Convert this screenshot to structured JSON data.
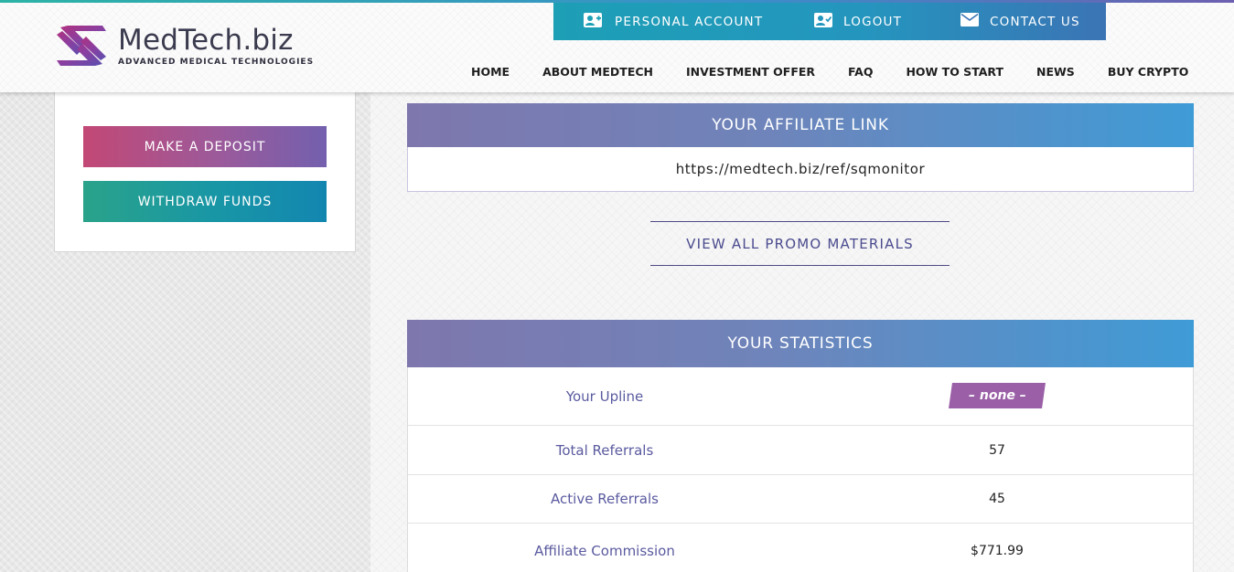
{
  "brand": {
    "name": "MedTech.biz",
    "tagline": "ADVANCED MEDICAL TECHNOLOGIES"
  },
  "topbar": {
    "items": [
      {
        "label": "PERSONAL ACCOUNT",
        "icon": "add-user-icon"
      },
      {
        "label": "LOGOUT",
        "icon": "user-check-icon"
      },
      {
        "label": "CONTACT US",
        "icon": "envelope-icon"
      }
    ]
  },
  "nav": {
    "items": [
      {
        "label": "HOME"
      },
      {
        "label": "ABOUT MEDTECH"
      },
      {
        "label": "INVESTMENT OFFER"
      },
      {
        "label": "FAQ"
      },
      {
        "label": "HOW TO START"
      },
      {
        "label": "NEWS"
      },
      {
        "label": "BUY CRYPTO"
      }
    ]
  },
  "sidebar": {
    "deposit_label": "MAKE A DEPOSIT",
    "withdraw_label": "WITHDRAW FUNDS"
  },
  "affiliate": {
    "title": "YOUR AFFILIATE LINK",
    "link": "https://medtech.biz/ref/sqmonitor",
    "promo_label": "VIEW ALL PROMO MATERIALS"
  },
  "statistics": {
    "title": "YOUR STATISTICS",
    "rows": [
      {
        "label": "Your Upline",
        "value": "– none –"
      },
      {
        "label": "Total Referrals",
        "value": "57"
      },
      {
        "label": "Active Referrals",
        "value": "45"
      },
      {
        "label": "Affiliate Commission",
        "value": "$771.99"
      }
    ]
  },
  "colors": {
    "topbar": "#2496be",
    "accent_purple": "#7e77ad",
    "accent_blue": "#3f9bd6",
    "deposit": "#c24876",
    "withdraw": "#1896a6",
    "upline_badge": "#9a5fa6"
  }
}
